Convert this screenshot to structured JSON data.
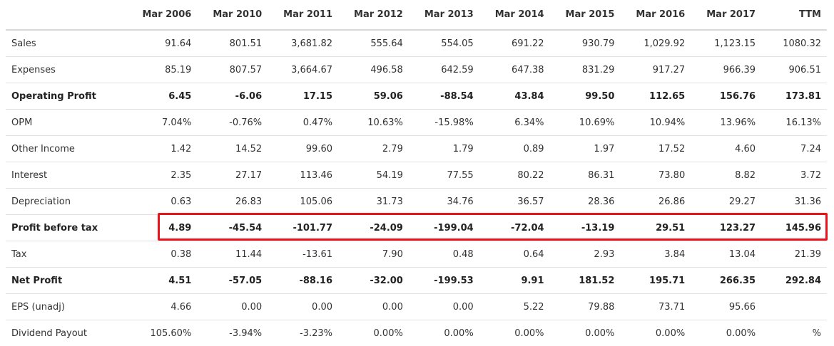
{
  "table": {
    "columns": [
      "",
      "Mar 2006",
      "Mar 2010",
      "Mar 2011",
      "Mar 2012",
      "Mar 2013",
      "Mar 2014",
      "Mar 2015",
      "Mar 2016",
      "Mar 2017",
      "TTM"
    ],
    "rows": [
      {
        "label": "Sales",
        "bold": false,
        "values": [
          "91.64",
          "801.51",
          "3,681.82",
          "555.64",
          "554.05",
          "691.22",
          "930.79",
          "1,029.92",
          "1,123.15",
          "1080.32"
        ]
      },
      {
        "label": "Expenses",
        "bold": false,
        "values": [
          "85.19",
          "807.57",
          "3,664.67",
          "496.58",
          "642.59",
          "647.38",
          "831.29",
          "917.27",
          "966.39",
          "906.51"
        ]
      },
      {
        "label": "Operating Profit",
        "bold": true,
        "values": [
          "6.45",
          "-6.06",
          "17.15",
          "59.06",
          "-88.54",
          "43.84",
          "99.50",
          "112.65",
          "156.76",
          "173.81"
        ]
      },
      {
        "label": "OPM",
        "bold": false,
        "values": [
          "7.04%",
          "-0.76%",
          "0.47%",
          "10.63%",
          "-15.98%",
          "6.34%",
          "10.69%",
          "10.94%",
          "13.96%",
          "16.13%"
        ]
      },
      {
        "label": "Other Income",
        "bold": false,
        "values": [
          "1.42",
          "14.52",
          "99.60",
          "2.79",
          "1.79",
          "0.89",
          "1.97",
          "17.52",
          "4.60",
          "7.24"
        ]
      },
      {
        "label": "Interest",
        "bold": false,
        "values": [
          "2.35",
          "27.17",
          "113.46",
          "54.19",
          "77.55",
          "80.22",
          "86.31",
          "73.80",
          "8.82",
          "3.72"
        ]
      },
      {
        "label": "Depreciation",
        "bold": false,
        "values": [
          "0.63",
          "26.83",
          "105.06",
          "31.73",
          "34.76",
          "36.57",
          "28.36",
          "26.86",
          "29.27",
          "31.36"
        ]
      },
      {
        "label": "Profit before tax",
        "bold": true,
        "values": [
          "4.89",
          "-45.54",
          "-101.77",
          "-24.09",
          "-199.04",
          "-72.04",
          "-13.19",
          "29.51",
          "123.27",
          "145.96"
        ]
      },
      {
        "label": "Tax",
        "bold": false,
        "values": [
          "0.38",
          "11.44",
          "-13.61",
          "7.90",
          "0.48",
          "0.64",
          "2.93",
          "3.84",
          "13.04",
          "21.39"
        ]
      },
      {
        "label": "Net Profit",
        "bold": true,
        "values": [
          "4.51",
          "-57.05",
          "-88.16",
          "-32.00",
          "-199.53",
          "9.91",
          "181.52",
          "195.71",
          "266.35",
          "292.84"
        ]
      },
      {
        "label": "EPS (unadj)",
        "bold": false,
        "values": [
          "4.66",
          "0.00",
          "0.00",
          "0.00",
          "0.00",
          "5.22",
          "79.88",
          "73.71",
          "95.66",
          ""
        ]
      },
      {
        "label": "Dividend Payout",
        "bold": false,
        "values": [
          "105.60%",
          "-3.94%",
          "-3.23%",
          "0.00%",
          "0.00%",
          "0.00%",
          "0.00%",
          "0.00%",
          "0.00%",
          "%"
        ]
      }
    ]
  },
  "highlight": {
    "row_label": "Profit before tax",
    "color": "#e8141c"
  }
}
